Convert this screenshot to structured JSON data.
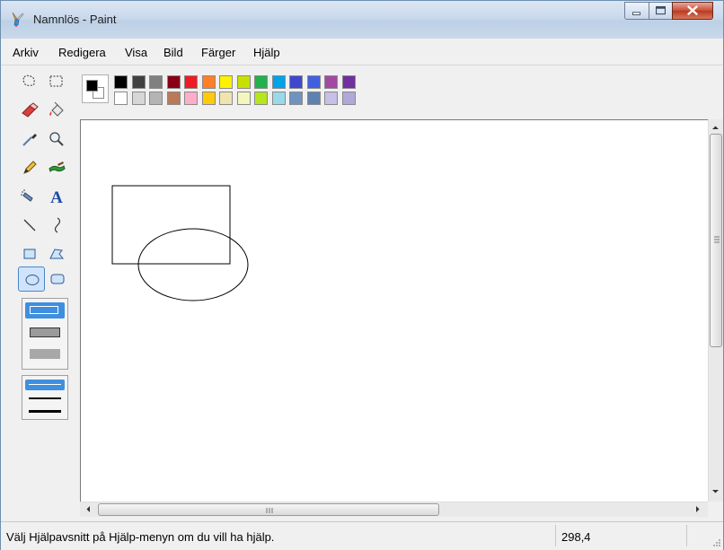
{
  "window": {
    "title": "Namnlös - Paint"
  },
  "menu": [
    {
      "label": "Arkiv"
    },
    {
      "label": "Redigera"
    },
    {
      "label": "Visa"
    },
    {
      "label": "Bild"
    },
    {
      "label": "Färger"
    },
    {
      "label": "Hjälp"
    }
  ],
  "tools": [
    {
      "name": "free-select-icon"
    },
    {
      "name": "rect-select-icon"
    },
    {
      "name": "eraser-icon"
    },
    {
      "name": "fill-icon"
    },
    {
      "name": "color-picker-icon"
    },
    {
      "name": "magnifier-icon"
    },
    {
      "name": "pencil-icon"
    },
    {
      "name": "brush-icon"
    },
    {
      "name": "airbrush-icon"
    },
    {
      "name": "text-icon",
      "glyph": "A"
    },
    {
      "name": "line-icon"
    },
    {
      "name": "curve-icon"
    },
    {
      "name": "rectangle-icon"
    },
    {
      "name": "polygon-icon"
    },
    {
      "name": "ellipse-icon",
      "selected": true
    },
    {
      "name": "rounded-rect-icon"
    }
  ],
  "palette": {
    "foreground": "#000000",
    "background": "#ffffff",
    "row1": [
      "#000000",
      "#404040",
      "#808080",
      "#880015",
      "#ed1c24",
      "#ff7f27",
      "#fff200",
      "#c8e000",
      "#22b14c",
      "#00a2e8",
      "#3f48cc",
      "#4060e0",
      "#a349a4",
      "#7030a0"
    ],
    "row2": [
      "#ffffff",
      "#d6d6d6",
      "#b4b4b4",
      "#b97a57",
      "#ffaec9",
      "#ffc90e",
      "#efe4b0",
      "#f5f5c0",
      "#b5e61d",
      "#99d9ea",
      "#7092be",
      "#5e81b0",
      "#c8bfe7",
      "#b0a8d8"
    ]
  },
  "status": {
    "help_text": "Välj Hjälpavsnitt på Hjälp-menyn om du vill ha hjälp.",
    "coords": "298,4"
  }
}
